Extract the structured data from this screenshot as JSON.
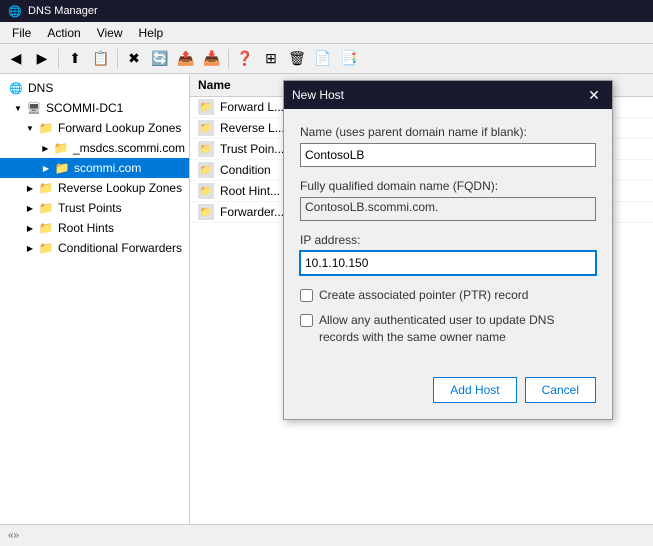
{
  "titleBar": {
    "icon": "🌐",
    "title": "DNS Manager"
  },
  "menuBar": {
    "items": [
      "File",
      "Action",
      "View",
      "Help"
    ]
  },
  "toolbar": {
    "buttons": [
      "◀",
      "▶",
      "⬆",
      "📋",
      "✖",
      "🔄",
      "📤",
      "📥",
      "❓",
      "⊞",
      "🗑",
      "📄",
      "📑"
    ]
  },
  "tree": {
    "root": "DNS",
    "server": "SCOMMI-DC1",
    "items": [
      {
        "label": "Forward Lookup Zones",
        "level": 2,
        "expanded": true
      },
      {
        "label": "_msdcs.scommi.com",
        "level": 3,
        "icon": "folder"
      },
      {
        "label": "scommi.com",
        "level": 3,
        "icon": "folder",
        "selected": true
      },
      {
        "label": "Reverse Lookup Zones",
        "level": 2,
        "expanded": false
      },
      {
        "label": "Trust Points",
        "level": 2,
        "expanded": false
      },
      {
        "label": "Root Hints",
        "level": 2,
        "expanded": false
      },
      {
        "label": "Conditional Forwarders",
        "level": 2,
        "expanded": false
      }
    ]
  },
  "contentPanel": {
    "columnHeader": "Name",
    "rows": [
      {
        "label": "Forward L..."
      },
      {
        "label": "Reverse L..."
      },
      {
        "label": "Trust Poin..."
      },
      {
        "label": "Condition"
      },
      {
        "label": "Root Hint..."
      },
      {
        "label": "Forwarder..."
      }
    ]
  },
  "dialog": {
    "title": "New Host",
    "fields": {
      "nameLabel": "Name (uses parent domain name if blank):",
      "nameValue": "ContosoLB",
      "fqdnLabel": "Fully qualified domain name (FQDN):",
      "fqdnValue": "ContosoLB.scommi.com.",
      "ipLabel": "IP address:",
      "ipValue": "10.1.10.150"
    },
    "checkboxes": {
      "ptr": {
        "label": "Create associated pointer (PTR) record",
        "checked": false
      },
      "allow": {
        "label": "Allow any authenticated user to update DNS records with the same owner name",
        "checked": false
      }
    },
    "buttons": {
      "addHost": "Add Host",
      "cancel": "Cancel"
    }
  },
  "statusBar": {
    "arrows": "«»"
  }
}
